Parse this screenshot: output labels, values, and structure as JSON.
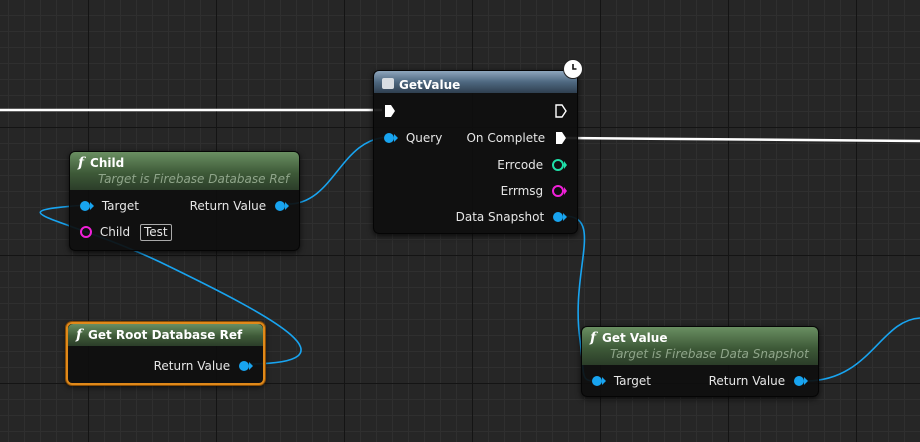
{
  "colors": {
    "pin_object": "#18a4f0",
    "pin_int": "#1fe0a8",
    "pin_string": "#f020d8",
    "wire_exec": "#ffffff",
    "wire_object": "#18a4f0",
    "selected_outline": "#e0891a"
  },
  "nodes": {
    "getvalue_latent": {
      "title": "GetValue",
      "icon": "database-icon",
      "badge_icon": "clock-icon",
      "pins": {
        "query": "Query",
        "on_complete": "On Complete",
        "errcode": "Errcode",
        "errmsg": "Errmsg",
        "data_snapshot": "Data Snapshot"
      }
    },
    "child": {
      "title": "Child",
      "subtitle": "Target is Firebase Database Ref",
      "pins": {
        "target": "Target",
        "return_value": "Return Value",
        "child": "Child",
        "child_value": "Test"
      }
    },
    "get_root": {
      "title": "Get Root Database Ref",
      "pins": {
        "return_value": "Return Value"
      }
    },
    "get_value": {
      "title": "Get Value",
      "subtitle": "Target is Firebase Data Snapshot",
      "pins": {
        "target": "Target",
        "return_value": "Return Value"
      }
    }
  }
}
